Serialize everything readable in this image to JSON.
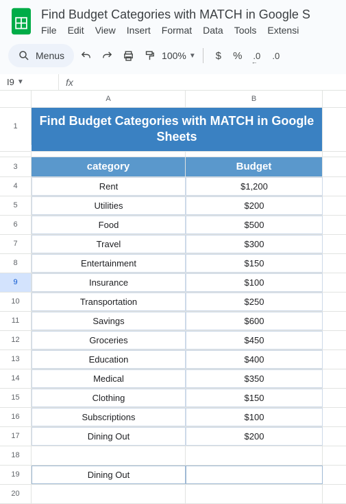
{
  "doc_title": "Find Budget Categories with MATCH in Google S",
  "menu": {
    "file": "File",
    "edit": "Edit",
    "view": "View",
    "insert": "Insert",
    "format": "Format",
    "data": "Data",
    "tools": "Tools",
    "extensions": "Extensi"
  },
  "toolbar": {
    "menus_label": "Menus",
    "zoom": "100%",
    "currency": "$",
    "percent": "%",
    "dec_dec": ".0",
    "inc_dec": ".0"
  },
  "namebox": "I9",
  "fx_label": "fx",
  "columns": {
    "a": "A",
    "b": "B"
  },
  "title_cell": "Find Budget Categories with MATCH in Google Sheets",
  "headers": {
    "category": "category",
    "budget": "Budget"
  },
  "rows": [
    {
      "n": 4,
      "cat": "Rent",
      "bud": "$1,200"
    },
    {
      "n": 5,
      "cat": "Utilities",
      "bud": "$200"
    },
    {
      "n": 6,
      "cat": "Food",
      "bud": "$500"
    },
    {
      "n": 7,
      "cat": "Travel",
      "bud": "$300"
    },
    {
      "n": 8,
      "cat": "Entertainment",
      "bud": "$150"
    },
    {
      "n": 9,
      "cat": "Insurance",
      "bud": "$100"
    },
    {
      "n": 10,
      "cat": "Transportation",
      "bud": "$250"
    },
    {
      "n": 11,
      "cat": "Savings",
      "bud": "$600"
    },
    {
      "n": 12,
      "cat": "Groceries",
      "bud": "$450"
    },
    {
      "n": 13,
      "cat": "Education",
      "bud": "$400"
    },
    {
      "n": 14,
      "cat": "Medical",
      "bud": "$350"
    },
    {
      "n": 15,
      "cat": "Clothing",
      "bud": "$150"
    },
    {
      "n": 16,
      "cat": "Subscriptions",
      "bud": "$100"
    },
    {
      "n": 17,
      "cat": "Dining Out",
      "bud": "$200"
    }
  ],
  "lookup_row": {
    "n": 19,
    "cat": "Dining Out",
    "bud": ""
  },
  "blank18": "18",
  "blank20": "20",
  "row1": "1",
  "row3": "3"
}
